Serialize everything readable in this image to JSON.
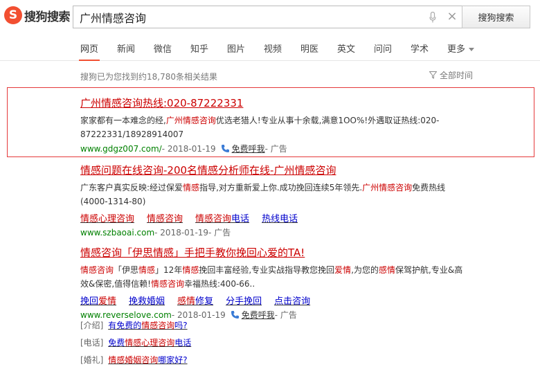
{
  "logo": {
    "mark": "S",
    "text": "搜狗搜索"
  },
  "search": {
    "query": "广州情感咨询",
    "button": "搜狗搜索"
  },
  "tabs": [
    "网页",
    "新闻",
    "微信",
    "知乎",
    "图片",
    "视频",
    "明医",
    "英文",
    "问问",
    "学术",
    "更多"
  ],
  "result_count": "搜狗已为您找到约18,780条相关结果",
  "time_filter": "全部时间",
  "results": [
    {
      "title": "广州情感咨询热线:020-87222331",
      "desc": [
        {
          "t": "家家都有一本难念的经,"
        },
        {
          "t": "广州情感咨询",
          "h": true
        },
        {
          "t": "优选老猎人!专业从事十余载,满意1OO%!外遇取证热线:020-87222331/18928914007"
        }
      ],
      "url": "www.gdgz007.com/",
      "date": " - 2018-01-19",
      "call": "免费呼我",
      "ad": " - 广告"
    },
    {
      "title": "情感问题在线咨询-200名情感分析师在线-广州情感咨询",
      "desc": [
        {
          "t": "广东客户真实反映:经过保爱"
        },
        {
          "t": "情感",
          "h": true
        },
        {
          "t": "指导,对方重新爱上你.成功挽回连续5年领先."
        },
        {
          "t": "广州情感咨询",
          "h": true
        },
        {
          "t": "免费热线(4000-1314-80)"
        }
      ],
      "sitelinks": [
        [
          {
            "t": "情感心理咨询",
            "h": true
          }
        ],
        [
          {
            "t": "情感咨询",
            "h": true
          }
        ],
        [
          {
            "t": "情感咨询",
            "h": true
          },
          {
            "t": "电话"
          }
        ],
        [
          {
            "t": "热线电话"
          }
        ]
      ],
      "url": "www.szbaoai.com",
      "date": " - 2018-01-19",
      "ad": " - 广告"
    },
    {
      "title": "情感咨询「伊思情感」手把手教你挽回心爱的TA!",
      "desc": [
        {
          "t": "情感咨询",
          "h": true
        },
        {
          "t": "「伊思"
        },
        {
          "t": "情感",
          "h": true
        },
        {
          "t": "」12年"
        },
        {
          "t": "情感",
          "h": true
        },
        {
          "t": "挽回丰富经验,专业实战指导教您挽回"
        },
        {
          "t": "爱情",
          "h": true
        },
        {
          "t": ",为您的"
        },
        {
          "t": "感情",
          "h": true
        },
        {
          "t": "保驾护航,专业&高效&保密,值得信赖!"
        },
        {
          "t": "情感咨询",
          "h": true
        },
        {
          "t": "幸福热线:400-66.."
        }
      ],
      "sitelinks": [
        [
          {
            "t": "挽回"
          },
          {
            "t": "爱情",
            "h": true
          }
        ],
        [
          {
            "t": "挽救婚姻"
          }
        ],
        [
          {
            "t": "感情",
            "h": true
          },
          {
            "t": "修复"
          }
        ],
        [
          {
            "t": "分手挽回"
          }
        ],
        [
          {
            "t": "点击咨询"
          }
        ]
      ],
      "url": "www.reverselove.com",
      "date": " - 2018-01-19",
      "call": "免费呼我",
      "ad": " - 广告"
    }
  ],
  "subrows": [
    {
      "tag": "[介绍]",
      "parts": [
        {
          "t": "有免费的"
        },
        {
          "t": "情感咨询",
          "h": true
        },
        {
          "t": "吗?"
        }
      ]
    },
    {
      "tag": "[电话]",
      "parts": [
        {
          "t": "免费"
        },
        {
          "t": "情感心理咨询",
          "h": true
        },
        {
          "t": "电话"
        }
      ]
    },
    {
      "tag": "[婚礼]",
      "parts": [
        {
          "t": "情感婚姻咨询",
          "h": true
        },
        {
          "t": "哪家好?"
        }
      ]
    }
  ]
}
